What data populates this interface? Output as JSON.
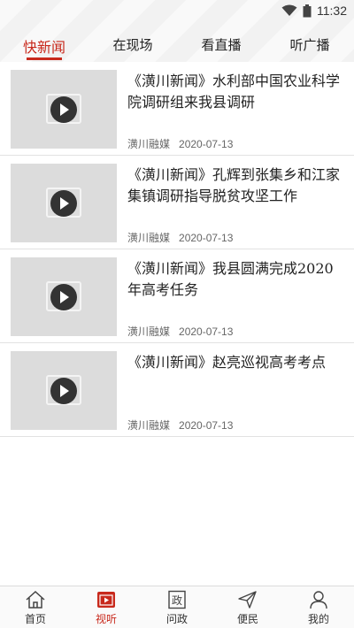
{
  "status_bar": {
    "time": "11:32"
  },
  "tabs": [
    {
      "label": "快新闻",
      "active": true
    },
    {
      "label": "在现场",
      "active": false
    },
    {
      "label": "看直播",
      "active": false
    },
    {
      "label": "听广播",
      "active": false
    }
  ],
  "news": [
    {
      "title": "《潢川新闻》水利部中国农业科学院调研组来我县调研",
      "source": "潢川融媒",
      "date": "2020-07-13"
    },
    {
      "title": "《潢川新闻》孔辉到张集乡和江家集镇调研指导脱贫攻坚工作",
      "source": "潢川融媒",
      "date": "2020-07-13"
    },
    {
      "title": "《潢川新闻》我县圆满完成2020年高考任务",
      "source": "潢川融媒",
      "date": "2020-07-13"
    },
    {
      "title": "《潢川新闻》赵亮巡视高考考点",
      "source": "潢川融媒",
      "date": "2020-07-13"
    }
  ],
  "bottom_nav": [
    {
      "label": "首页",
      "icon": "home-icon",
      "active": false
    },
    {
      "label": "视听",
      "icon": "video-icon",
      "active": true
    },
    {
      "label": "问政",
      "icon": "politics-icon",
      "active": false
    },
    {
      "label": "便民",
      "icon": "send-icon",
      "active": false
    },
    {
      "label": "我的",
      "icon": "user-icon",
      "active": false
    }
  ],
  "colors": {
    "accent": "#c8291c",
    "thumb_bg": "#dcdcdc"
  }
}
